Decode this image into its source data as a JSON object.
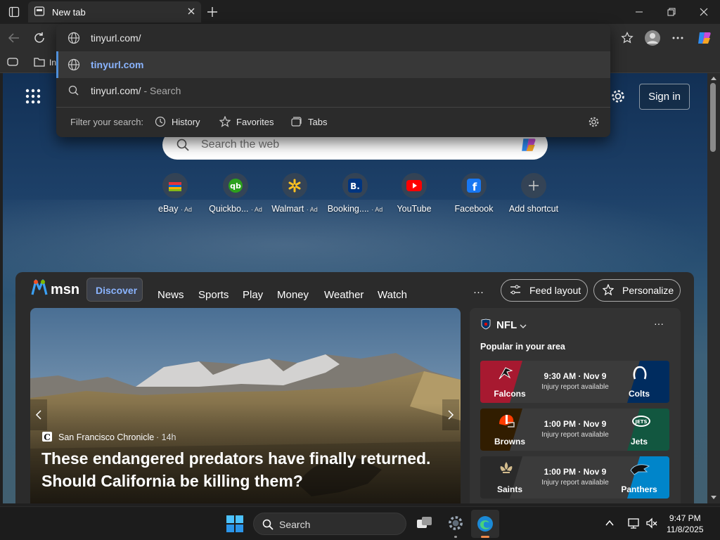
{
  "titlebar": {
    "tab_title": "New tab"
  },
  "address": {
    "typed": "tinyurl.com/"
  },
  "dropdown": {
    "suggestion_1": "tinyurl.com",
    "suggestion_2": "tinyurl.com/",
    "suggestion_2_suffix": "- Search",
    "filter_label": "Filter your search:",
    "filters": [
      "History",
      "Favorites",
      "Tabs"
    ]
  },
  "favbar": {
    "partial_text": "In"
  },
  "page": {
    "signin": "Sign in",
    "search_placeholder": "Search the web",
    "shortcuts": [
      {
        "label": "eBay",
        "ad": "· Ad"
      },
      {
        "label": "Quickbo...",
        "ad": "· Ad"
      },
      {
        "label": "Walmart",
        "ad": "· Ad"
      },
      {
        "label": "Booking....",
        "ad": "· Ad"
      },
      {
        "label": "YouTube",
        "ad": ""
      },
      {
        "label": "Facebook",
        "ad": ""
      },
      {
        "label": "Add shortcut",
        "ad": ""
      }
    ]
  },
  "feed": {
    "brand": "msn",
    "tabs": [
      "Discover",
      "News",
      "Sports",
      "Play",
      "Money",
      "Weather",
      "Watch"
    ],
    "more": "···",
    "feed_layout": "Feed layout",
    "personalize": "Personalize",
    "hero": {
      "source": "San Francisco Chronicle",
      "age": "· 14h",
      "headline": "These endangered predators have finally returned. Should California be killing them?"
    },
    "nfl": {
      "title": "NFL",
      "subtitle": "Popular in your area",
      "games": [
        {
          "away": "Falcons",
          "home": "Colts",
          "time": "9:30 AM · Nov 9",
          "note": "Injury report available",
          "away_color": "#a71930",
          "home_color": "#002c5f"
        },
        {
          "away": "Browns",
          "home": "Jets",
          "time": "1:00 PM · Nov 9",
          "note": "Injury report available",
          "away_color": "#311d00",
          "home_color": "#125740"
        },
        {
          "away": "Saints",
          "home": "Panthers",
          "time": "1:00 PM · Nov 9",
          "note": "Injury report available",
          "away_color": "#2a2a2a",
          "home_color": "#0085ca"
        }
      ]
    }
  },
  "taskbar": {
    "search": "Search",
    "time": "9:47 PM",
    "date": "11/8/2025"
  }
}
